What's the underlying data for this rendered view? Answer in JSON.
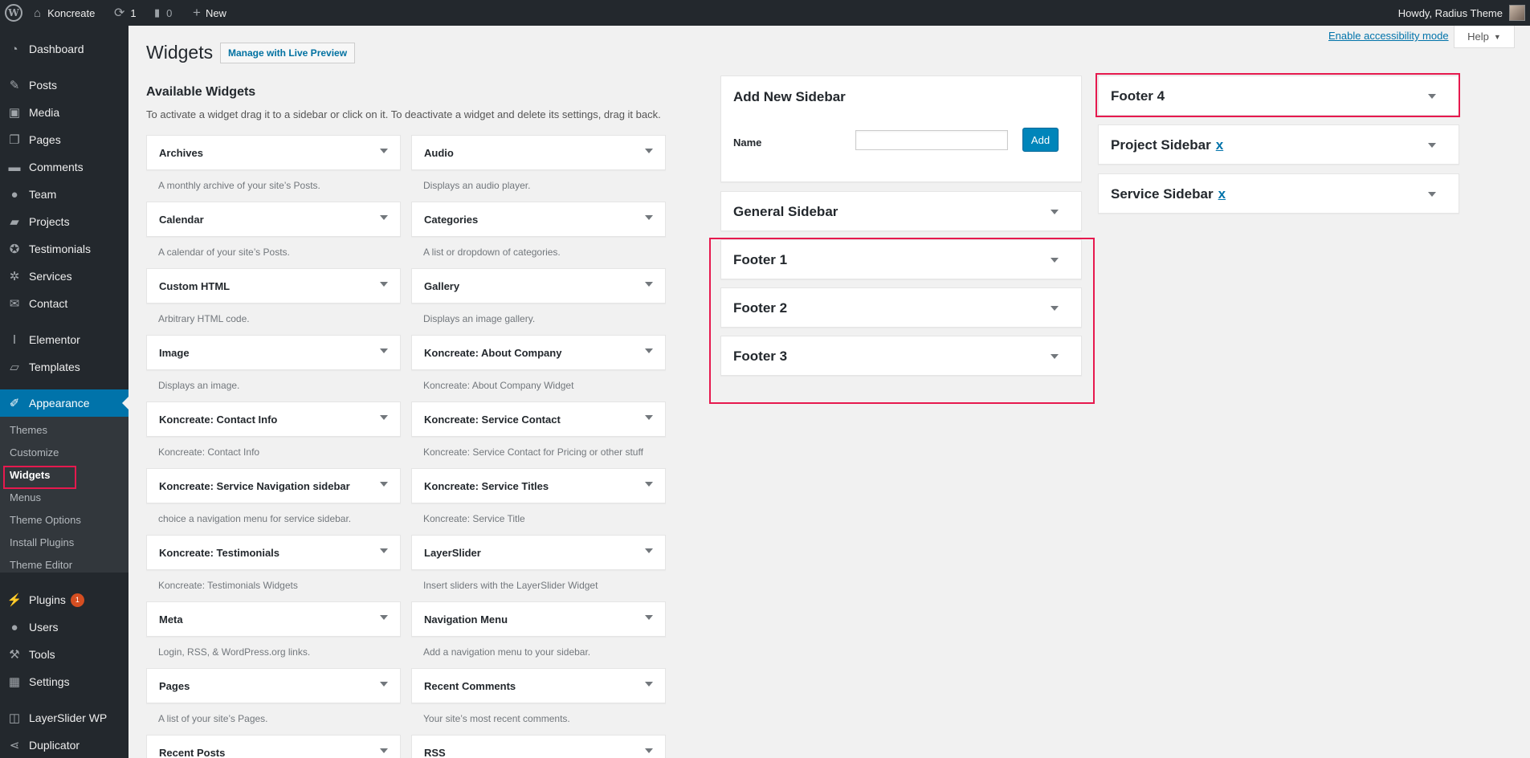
{
  "adminbar": {
    "site_name": "Koncreate",
    "updates_count": "1",
    "comments_count": "0",
    "new_label": "New",
    "greeting": "Howdy, Radius Theme"
  },
  "menu": {
    "dashboard": "Dashboard",
    "posts": "Posts",
    "media": "Media",
    "pages": "Pages",
    "comments": "Comments",
    "team": "Team",
    "projects": "Projects",
    "testimonials": "Testimonials",
    "services": "Services",
    "contact": "Contact",
    "elementor": "Elementor",
    "templates": "Templates",
    "appearance": "Appearance",
    "plugins": "Plugins",
    "plugins_badge": "1",
    "users": "Users",
    "tools": "Tools",
    "settings": "Settings",
    "layerslider": "LayerSlider WP",
    "duplicator": "Duplicator"
  },
  "submenu": {
    "themes": "Themes",
    "customize": "Customize",
    "widgets": "Widgets",
    "menus": "Menus",
    "theme_options": "Theme Options",
    "install_plugins": "Install Plugins",
    "theme_editor": "Theme Editor"
  },
  "header": {
    "title": "Widgets",
    "live_preview": "Manage with Live Preview",
    "accessibility": "Enable accessibility mode",
    "help": "Help"
  },
  "available": {
    "title": "Available Widgets",
    "description": "To activate a widget drag it to a sidebar or click on it. To deactivate a widget and delete its settings, drag it back."
  },
  "widgets": [
    {
      "name": "Archives",
      "desc": "A monthly archive of your site’s Posts."
    },
    {
      "name": "Audio",
      "desc": "Displays an audio player."
    },
    {
      "name": "Calendar",
      "desc": "A calendar of your site’s Posts."
    },
    {
      "name": "Categories",
      "desc": "A list or dropdown of categories."
    },
    {
      "name": "Custom HTML",
      "desc": "Arbitrary HTML code."
    },
    {
      "name": "Gallery",
      "desc": "Displays an image gallery."
    },
    {
      "name": "Image",
      "desc": "Displays an image."
    },
    {
      "name": "Koncreate: About Company",
      "desc": "Koncreate: About Company Widget"
    },
    {
      "name": "Koncreate: Contact Info",
      "desc": "Koncreate: Contact Info"
    },
    {
      "name": "Koncreate: Service Contact",
      "desc": "Koncreate: Service Contact for Pricing or other stuff"
    },
    {
      "name": "Koncreate: Service Navigation sidebar",
      "desc": "choice a navigation menu for service sidebar."
    },
    {
      "name": "Koncreate: Service Titles",
      "desc": "Koncreate: Service Title"
    },
    {
      "name": "Koncreate: Testimonials",
      "desc": "Koncreate: Testimonials Widgets"
    },
    {
      "name": "LayerSlider",
      "desc": "Insert sliders with the LayerSlider Widget"
    },
    {
      "name": "Meta",
      "desc": "Login, RSS, & WordPress.org links."
    },
    {
      "name": "Navigation Menu",
      "desc": "Add a navigation menu to your sidebar."
    },
    {
      "name": "Pages",
      "desc": "A list of your site’s Pages."
    },
    {
      "name": "Recent Comments",
      "desc": "Your site’s most recent comments."
    },
    {
      "name": "Recent Posts",
      "desc": ""
    },
    {
      "name": "RSS",
      "desc": ""
    }
  ],
  "add_sidebar": {
    "title": "Add New Sidebar",
    "name_label": "Name",
    "name_value": "",
    "add_button": "Add"
  },
  "sidebars": {
    "general": "General Sidebar",
    "footer1": "Footer 1",
    "footer2": "Footer 2",
    "footer3": "Footer 3",
    "footer4": "Footer 4",
    "project": "Project Sidebar",
    "service": "Service Sidebar",
    "remove_x": "x"
  },
  "colors": {
    "highlight": "#e6194e",
    "accent": "#0073aa",
    "adminbar": "#23282d"
  }
}
